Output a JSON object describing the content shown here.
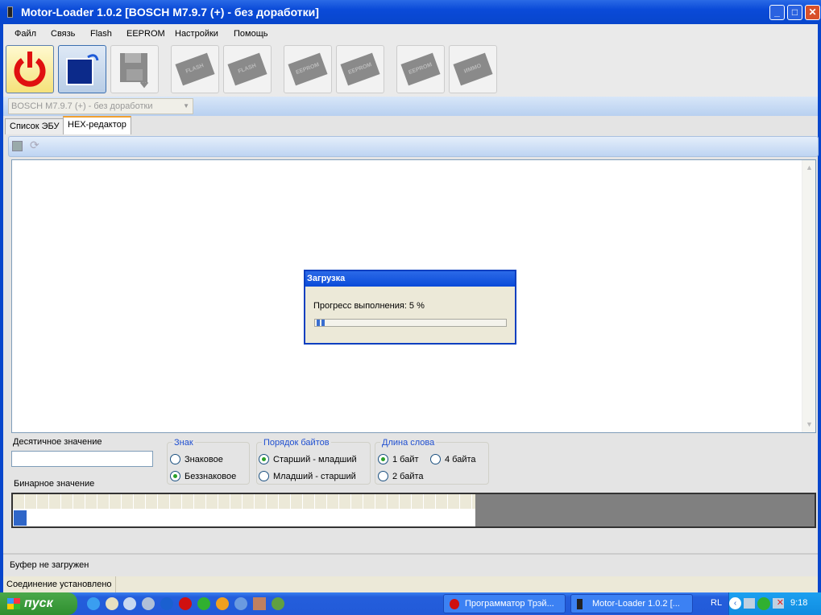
{
  "window": {
    "title": "Motor-Loader 1.0.2 [BOSCH M7.9.7 (+) - без доработки]",
    "buttons": [
      "minimize",
      "maximize",
      "close"
    ]
  },
  "menu": [
    "Файл",
    "Связь",
    "Flash",
    "EEPROM",
    "Настройки",
    "Помощь"
  ],
  "toolbar": {
    "buttons": [
      {
        "name": "power",
        "icon": "power-icon"
      },
      {
        "name": "open",
        "icon": "folder-open-icon"
      },
      {
        "name": "save",
        "icon": "floppy-icon"
      },
      {
        "name": "read-flash",
        "icon": "chip-read-icon",
        "label": "FLASH"
      },
      {
        "name": "write-flash",
        "icon": "chip-write-icon",
        "label": "FLASH"
      },
      {
        "name": "read-eeprom",
        "icon": "chip-read-icon",
        "label": "EEPROM"
      },
      {
        "name": "write-eeprom",
        "icon": "chip-write-icon",
        "label": "EEPROM"
      },
      {
        "name": "erase-eeprom",
        "icon": "chip-erase-icon",
        "label": "EEPROM"
      },
      {
        "name": "immo-off",
        "icon": "chip-x-icon",
        "label": "ИММО"
      }
    ]
  },
  "ecu_select": {
    "value": "BOSCH M7.9.7 (+) - без доработки"
  },
  "tabs": [
    {
      "label": "Список ЭБУ",
      "active": false
    },
    {
      "label": "HEX-редактор",
      "active": true
    }
  ],
  "dialog": {
    "title": "Загрузка",
    "message": "Прогресс выполнения: 5 %",
    "progress_percent": 5
  },
  "controls": {
    "decimal_label": "Десятичное значение",
    "decimal_value": "",
    "binary_label": "Бинарное значение",
    "sign": {
      "title": "Знак",
      "options": [
        "Знаковое",
        "Беззнаковое"
      ],
      "selected": 1
    },
    "byte_order": {
      "title": "Порядок байтов",
      "options": [
        "Старший - младший",
        "Младший - старший"
      ],
      "selected": 0
    },
    "word_length": {
      "title": "Длина слова",
      "options": [
        "1 байт",
        "4 байта",
        "2 байта"
      ],
      "selected": 0
    }
  },
  "status": {
    "buffer": "Буфер не загружен",
    "connection": "Соединение установлено"
  },
  "taskbar": {
    "start": "пуск",
    "tasks": [
      "Программатор Трэй...",
      "Motor-Loader 1.0.2 [..."
    ],
    "lang": "RL",
    "clock": "9:18"
  }
}
